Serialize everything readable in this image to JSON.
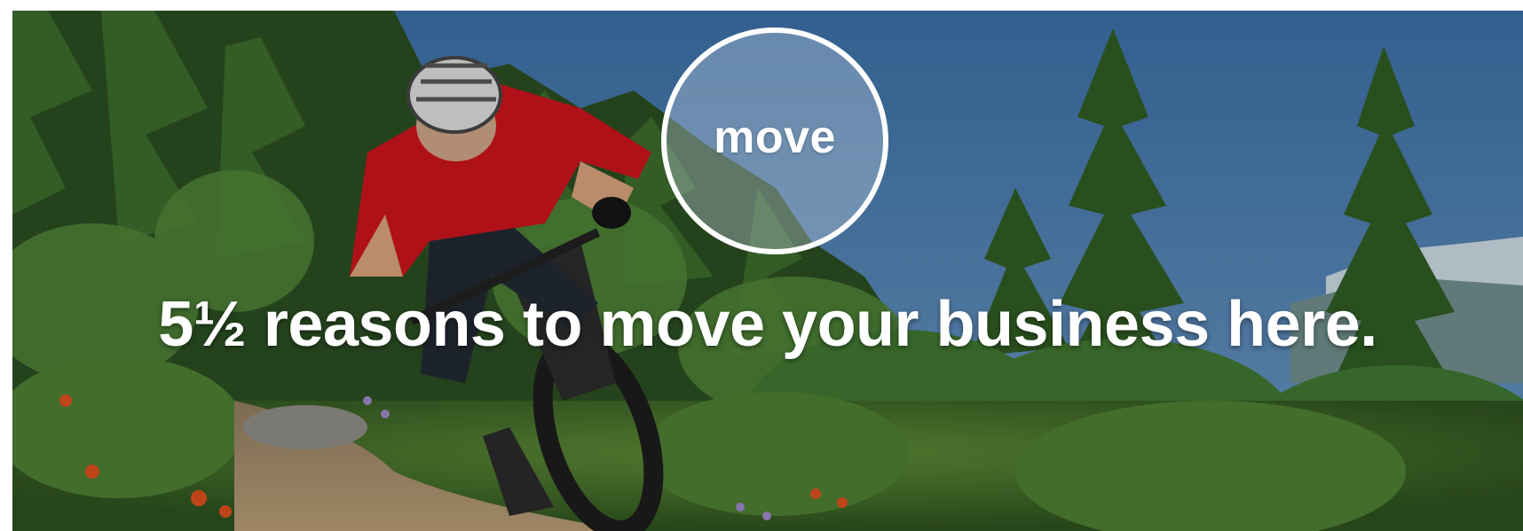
{
  "hero": {
    "badge_label": "move",
    "headline": "5½ reasons to move your business here."
  },
  "icons": {
    "badge": "circle-badge",
    "scene": "mountain-biker-forest-photo"
  },
  "colors": {
    "sky": "#3f74a8",
    "forest_dark": "#1f3d1b",
    "forest_mid": "#3d6b2a",
    "rider_jersey": "#c8141c",
    "text": "#ffffff"
  }
}
